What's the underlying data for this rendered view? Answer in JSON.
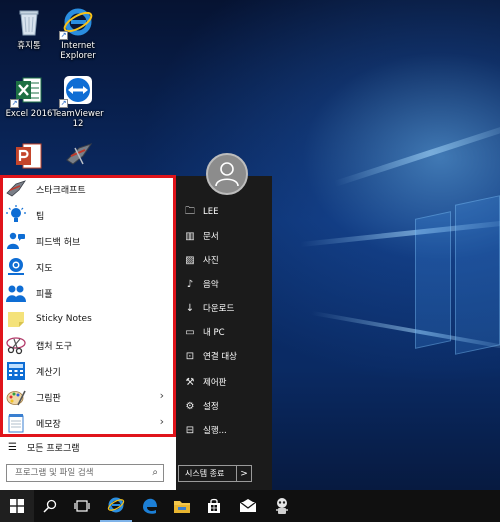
{
  "desktop_icons": [
    {
      "label": "휴지통",
      "icon": "recycle-bin-icon"
    },
    {
      "label": "Internet\nExplorer",
      "icon": "internet-explorer-icon"
    },
    {
      "label": "Excel 2016",
      "icon": "excel-icon"
    },
    {
      "label": "TeamViewer\n12",
      "icon": "teamviewer-icon"
    },
    {
      "label": "",
      "icon": "powerpoint-icon"
    },
    {
      "label": "",
      "icon": "starcraft-icon"
    }
  ],
  "start_menu": {
    "apps": [
      {
        "label": "스타크래프트",
        "icon": "starcraft-icon",
        "submenu": false
      },
      {
        "label": "팁",
        "icon": "tips-bulb-icon",
        "submenu": false
      },
      {
        "label": "피드백 허브",
        "icon": "feedback-hub-icon",
        "submenu": false
      },
      {
        "label": "지도",
        "icon": "maps-icon",
        "submenu": false
      },
      {
        "label": "피플",
        "icon": "people-icon",
        "submenu": false
      },
      {
        "label": "Sticky Notes",
        "icon": "sticky-notes-icon",
        "submenu": false
      },
      {
        "label": "캡처 도구",
        "icon": "snipping-tool-icon",
        "submenu": false
      },
      {
        "label": "계산기",
        "icon": "calculator-icon",
        "submenu": false
      },
      {
        "label": "그림판",
        "icon": "paint-icon",
        "submenu": true
      },
      {
        "label": "메모장",
        "icon": "notepad-icon",
        "submenu": true
      }
    ],
    "all_programs_label": "모든 프로그램",
    "search_placeholder": "프로그램 및 파일 검색",
    "right_items": [
      {
        "label": "LEE",
        "icon": "user-folder-icon"
      },
      {
        "label": "문서",
        "icon": "documents-icon"
      },
      {
        "label": "사진",
        "icon": "pictures-icon"
      },
      {
        "label": "음악",
        "icon": "music-icon"
      },
      {
        "label": "다운로드",
        "icon": "downloads-icon"
      },
      {
        "label": "내 PC",
        "icon": "this-pc-icon"
      },
      {
        "label": "연결 대상",
        "icon": "connect-icon"
      },
      {
        "label": "제어판",
        "icon": "control-panel-icon"
      },
      {
        "label": "설정",
        "icon": "settings-gear-icon"
      },
      {
        "label": "실행...",
        "icon": "run-icon"
      }
    ],
    "shutdown_label": "시스템 종료",
    "shutdown_arrow": ">"
  },
  "taskbar": {
    "items": [
      "start-button",
      "search-button",
      "task-view-button",
      "internet-explorer",
      "edge",
      "file-explorer",
      "store",
      "mail",
      "pinned-app"
    ]
  },
  "colors": {
    "highlight_frame": "#e0141b",
    "start_right_bg": "#1b1b1b",
    "taskbar_bg": "#101010"
  }
}
